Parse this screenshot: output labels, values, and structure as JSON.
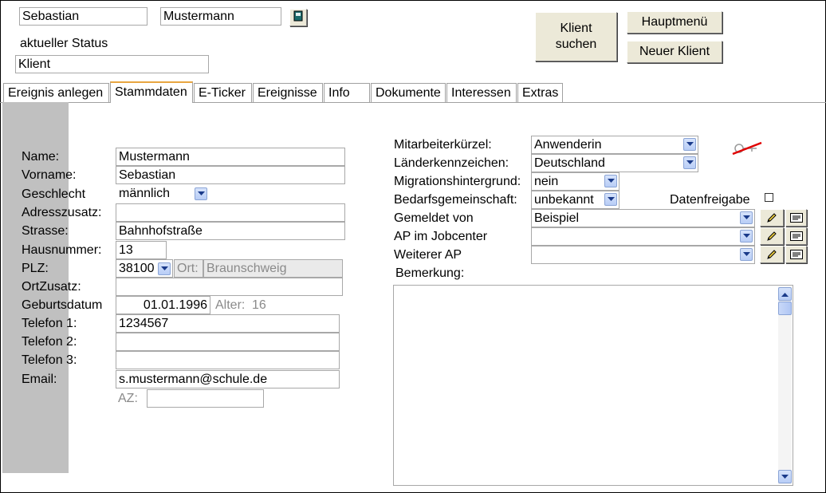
{
  "header": {
    "first_name": "Sebastian",
    "last_name": "Mustermann",
    "status_label": "aktueller Status",
    "status_value": "Klient",
    "search_button": "Klient suchen",
    "main_menu_button": "Hauptmenü",
    "new_client_button": "Neuer Klient"
  },
  "tabs": [
    {
      "label": "Ereignis anlegen"
    },
    {
      "label": "Stammdaten"
    },
    {
      "label": "E-Ticker"
    },
    {
      "label": "Ereignisse"
    },
    {
      "label": "Info"
    },
    {
      "label": "Dokumente"
    },
    {
      "label": "Interessen"
    },
    {
      "label": "Extras"
    }
  ],
  "active_tab": "Stammdaten",
  "left_form": {
    "name_label": "Name:",
    "name_value": "Mustermann",
    "vorname_label": "Vorname:",
    "vorname_value": "Sebastian",
    "geschlecht_label": "Geschlecht",
    "geschlecht_value": "männlich",
    "adresszusatz_label": "Adresszusatz:",
    "adresszusatz_value": "",
    "strasse_label": "Strasse:",
    "strasse_value": "Bahnhofstraße",
    "hausnummer_label": "Hausnummer:",
    "hausnummer_value": "13",
    "plz_label": "PLZ:",
    "plz_value": "38100",
    "ort_label": "Ort:",
    "ort_value": "Braunschweig",
    "ortzusatz_label": "OrtZusatz:",
    "ortzusatz_value": "",
    "geburtsdatum_label": "Geburtsdatum",
    "geburtsdatum_value": "01.01.1996",
    "alter_label": "Alter:",
    "alter_value": "16",
    "telefon1_label": "Telefon 1:",
    "telefon1_value": "1234567",
    "telefon2_label": "Telefon 2:",
    "telefon2_value": "",
    "telefon3_label": "Telefon 3:",
    "telefon3_value": "",
    "email_label": "Email:",
    "email_value": "s.mustermann@schule.de",
    "az_label": "AZ:",
    "az_value": ""
  },
  "right_form": {
    "mitarbeiter_label": "Mitarbeiterkürzel:",
    "mitarbeiter_value": "Anwenderin",
    "laender_label": "Länderkennzeichen:",
    "laender_value": "Deutschland",
    "migration_label": "Migrationshintergrund:",
    "migration_value": "nein",
    "bedarf_label": "Bedarfsgemeinschaft:",
    "bedarf_value": "unbekannt",
    "datenfreigabe_label": "Datenfreigabe",
    "datenfreigabe_checked": false,
    "gemeldet_label": "Gemeldet von",
    "gemeldet_value": "Beispiel",
    "ap_label": "AP im Jobcenter",
    "ap_value": "",
    "weiterer_label": "Weiterer AP",
    "weiterer_value": "",
    "bemerkung_label": "Bemerkung:",
    "bemerkung_value": ""
  },
  "icons": {
    "header_book": "book-icon",
    "key": "key-icon",
    "edit": "pencil-icon",
    "card": "card-icon"
  },
  "colors": {
    "active_tab_accent": "#e8a640",
    "sidebar": "#c0c0c0",
    "button_face": "#ece9d8",
    "readonly_text": "#8a8a8a"
  }
}
